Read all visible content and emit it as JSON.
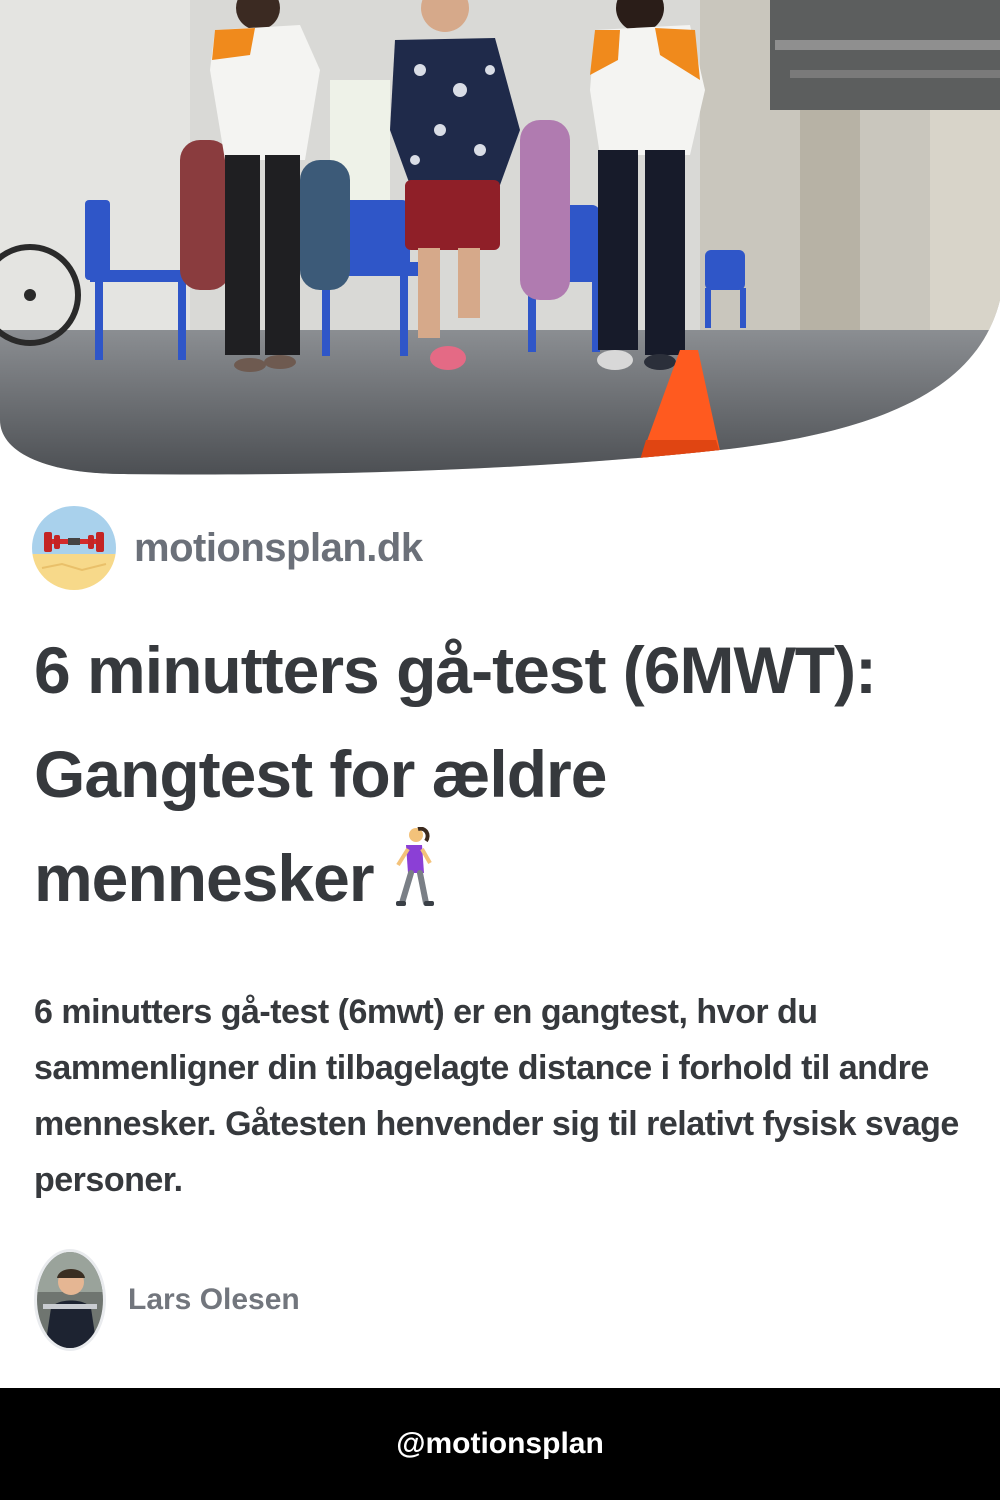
{
  "hero": {
    "image": "photo-elderly-walking-test-with-cone"
  },
  "site": {
    "name": "motionsplan.dk",
    "logo_icon": "dumbbell-logo-icon"
  },
  "article": {
    "title_line1": "6 minutters gå-test (6MWT):",
    "title_line2": "Gangtest for ældre",
    "title_line3": "mennesker",
    "title_emoji": "woman-walking-icon",
    "description": "6 minutters gå-test (6mwt) er en gangtest, hvor du sammenligner din tilbagelagte distance i forhold til andre mennesker. Gåtesten henvender sig til relativt fysisk svage personer."
  },
  "author": {
    "name": "Lars Olesen",
    "avatar": "author-avatar"
  },
  "footer": {
    "handle": "@motionsplan"
  },
  "colors": {
    "text": "#36393d",
    "muted": "#6b7079",
    "footer_bg": "#000000",
    "cone": "#ff5a1f"
  }
}
